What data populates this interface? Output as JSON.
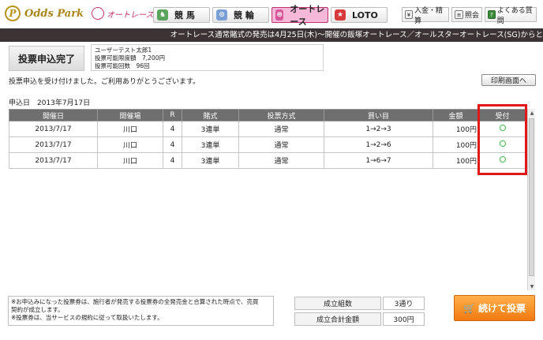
{
  "header": {
    "logo_mark": "P",
    "logo_text": "Odds Park",
    "sub_logo": "オートレース",
    "tabs": [
      {
        "label": "競 馬",
        "icon": "horse-icon"
      },
      {
        "label": "競 輪",
        "icon": "bicycle-icon"
      },
      {
        "label": "オートレース",
        "icon": "motorbike-icon"
      },
      {
        "label": "LOTO",
        "icon": "loto-icon"
      }
    ],
    "utility": {
      "deposit": "入金・精算",
      "inquiry": "照会",
      "faq": "よくある質問"
    }
  },
  "ticker": "オートレース通常賭式の発売は4月25日(木)〜開催の飯塚オートレース／オールスターオートレース(SG)からと",
  "completion": {
    "title": "投票申込完了",
    "user_line1": "ユーザーテスト太郎1",
    "user_line2": "投票可能限度額　7,200円",
    "user_line3": "投票可能回数　96回",
    "thanks": "投票申込を受け付けました。ご利用ありがとうございます。",
    "print_button": "印刷画面へ",
    "apply_date": "申込日　2013年7月17日"
  },
  "table": {
    "headers": [
      "開催日",
      "開催場",
      "R",
      "賭式",
      "投票方式",
      "買い目",
      "金額",
      "受付"
    ],
    "rows": [
      {
        "date": "2013/7/17",
        "venue": "川口",
        "race": "4",
        "bet_type": "3連単",
        "method": "通常",
        "combo": "1→2→3",
        "amount": "100円"
      },
      {
        "date": "2013/7/17",
        "venue": "川口",
        "race": "4",
        "bet_type": "3連単",
        "method": "通常",
        "combo": "1→2→6",
        "amount": "100円"
      },
      {
        "date": "2013/7/17",
        "venue": "川口",
        "race": "4",
        "bet_type": "3連単",
        "method": "通常",
        "combo": "1→6→7",
        "amount": "100円"
      }
    ]
  },
  "footer": {
    "notice_line1": "※お申込みになった投票券は、施行者が発売する投票券の全発売金と合算された時点で、売買",
    "notice_line2": "契約が成立します。",
    "notice_line3": "※投票券は、当サービスの規約に従って取扱いたします。",
    "summary": {
      "count_label": "成立組数",
      "count_value": "3通り",
      "total_label": "成立合計金額",
      "total_value": "300円"
    },
    "continue_button": "続けて投票"
  },
  "colors": {
    "ticker_bg": "#3c3434",
    "table_header_bg": "#6f6f6f",
    "accept_mark": "#4ab84a",
    "highlight": "#e01818",
    "continue_button": "#f17a10",
    "active_tab": "#f6b8d8"
  }
}
